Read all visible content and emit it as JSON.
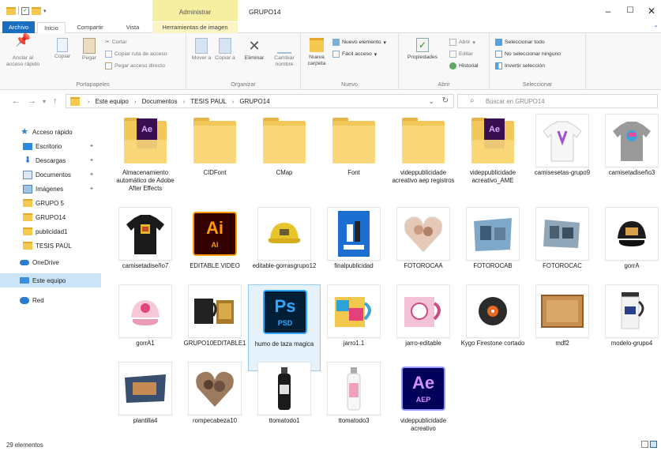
{
  "window": {
    "title": "GRUPO14",
    "context_tab": "Administrar"
  },
  "tabs": {
    "file": "Archivo",
    "home": "Inicio",
    "share": "Compartir",
    "view": "Vista",
    "image_tools": "Herramientas de imagen"
  },
  "ribbon": {
    "clipboard": {
      "label": "Portapapeles",
      "pin": "Anclar al acceso rápido",
      "copy": "Copiar",
      "paste": "Pegar",
      "cut": "Cortar",
      "copy_path": "Copiar ruta de acceso",
      "paste_shortcut": "Pegar acceso directo"
    },
    "organize": {
      "label": "Organizar",
      "move": "Mover a",
      "copy_to": "Copiar a",
      "delete": "Eliminar",
      "rename": "Cambiar nombre"
    },
    "new": {
      "label": "Nuevo",
      "new_folder": "Nueva carpeta",
      "new_item": "Nuevo elemento",
      "easy_access": "Fácil acceso"
    },
    "open": {
      "label": "Abrir",
      "properties": "Propiedades",
      "open": "Abrir",
      "edit": "Editar",
      "history": "Historial"
    },
    "select": {
      "label": "Seleccionar",
      "select_all": "Seleccionar todo",
      "select_none": "No seleccionar ninguno",
      "invert": "Invertir selección"
    }
  },
  "address": {
    "crumbs": [
      "Este equipo",
      "Documentos",
      "TESIS PAUL",
      "GRUPO14"
    ],
    "search_placeholder": "Buscar en GRUPO14"
  },
  "nav": {
    "items": [
      {
        "label": "Acceso rápido",
        "icon": "star-icon"
      },
      {
        "label": "Escritorio",
        "icon": "desktop-icon",
        "pinned": true
      },
      {
        "label": "Descargas",
        "icon": "download-icon",
        "pinned": true
      },
      {
        "label": "Documentos",
        "icon": "document-icon",
        "pinned": true
      },
      {
        "label": "Imágenes",
        "icon": "images-icon",
        "pinned": true
      },
      {
        "label": "GRUPO 5",
        "icon": "folder-icon"
      },
      {
        "label": "GRUPO14",
        "icon": "folder-icon"
      },
      {
        "label": "publicidad1",
        "icon": "folder-icon"
      },
      {
        "label": "TESIS PAÚL",
        "icon": "folder-icon"
      },
      {
        "label": "OneDrive",
        "icon": "onedrive-icon"
      },
      {
        "label": "Este equipo",
        "icon": "pc-icon",
        "selected": true
      },
      {
        "label": "Red",
        "icon": "network-icon"
      }
    ]
  },
  "files": [
    {
      "name": "Almacenamiento automático de Adobe After Effects",
      "kind": "folder-ae"
    },
    {
      "name": "CIDFont",
      "kind": "folder"
    },
    {
      "name": "CMap",
      "kind": "folder"
    },
    {
      "name": "Font",
      "kind": "folder"
    },
    {
      "name": "videppublicidade acreativo aep registros",
      "kind": "folder"
    },
    {
      "name": "videppublicidade acreativo_AME",
      "kind": "folder-ae"
    },
    {
      "name": "camisesetas-grupo9",
      "kind": "shirt-white"
    },
    {
      "name": "camisetadiseño3",
      "kind": "shirt-gray"
    },
    {
      "name": "camisetadiseño7",
      "kind": "shirt-black"
    },
    {
      "name": "EDITABLE VIDEO",
      "kind": "ai"
    },
    {
      "name": "editable-gorrasgrupo12",
      "kind": "cap-yellow"
    },
    {
      "name": "finalpublicidad",
      "kind": "poster"
    },
    {
      "name": "FOTOROCAA",
      "kind": "heart"
    },
    {
      "name": "FOTOROCAB",
      "kind": "photo-rock"
    },
    {
      "name": "FOTOROCAC",
      "kind": "photo-rock2"
    },
    {
      "name": "gorrA",
      "kind": "cap-black"
    },
    {
      "name": "gorrA1",
      "kind": "cap-pink"
    },
    {
      "name": "GRUPO10EDITABLE1",
      "kind": "mug-black"
    },
    {
      "name": "humo de taza magica",
      "kind": "ps",
      "selected": true
    },
    {
      "name": "jarro1.1",
      "kind": "mug-color"
    },
    {
      "name": "jarro-editable",
      "kind": "mug-pink"
    },
    {
      "name": "Kygo  Firestone cortado",
      "kind": "audio"
    },
    {
      "name": "mdf2",
      "kind": "wood"
    },
    {
      "name": "modelo-grupo4",
      "kind": "travel-mug"
    },
    {
      "name": "plantilla4",
      "kind": "plate"
    },
    {
      "name": "rompecabeza10",
      "kind": "puzzle-heart"
    },
    {
      "name": "ttomatodo1",
      "kind": "bottle-black"
    },
    {
      "name": "ttomatodo3",
      "kind": "bottle-white"
    },
    {
      "name": "videppublicidade acreativo",
      "kind": "aep"
    }
  ],
  "app_icons": {
    "ai": {
      "big": "Ai",
      "small": "AI"
    },
    "ps": {
      "big": "Ps",
      "small": "PSD"
    },
    "aep": {
      "big": "Ae",
      "small": "AEP"
    }
  },
  "status": {
    "count": "29 elementos"
  },
  "colors": {
    "accent": "#1a6ec0",
    "folder": "#f3c94f",
    "selection": "#cce4f7"
  }
}
